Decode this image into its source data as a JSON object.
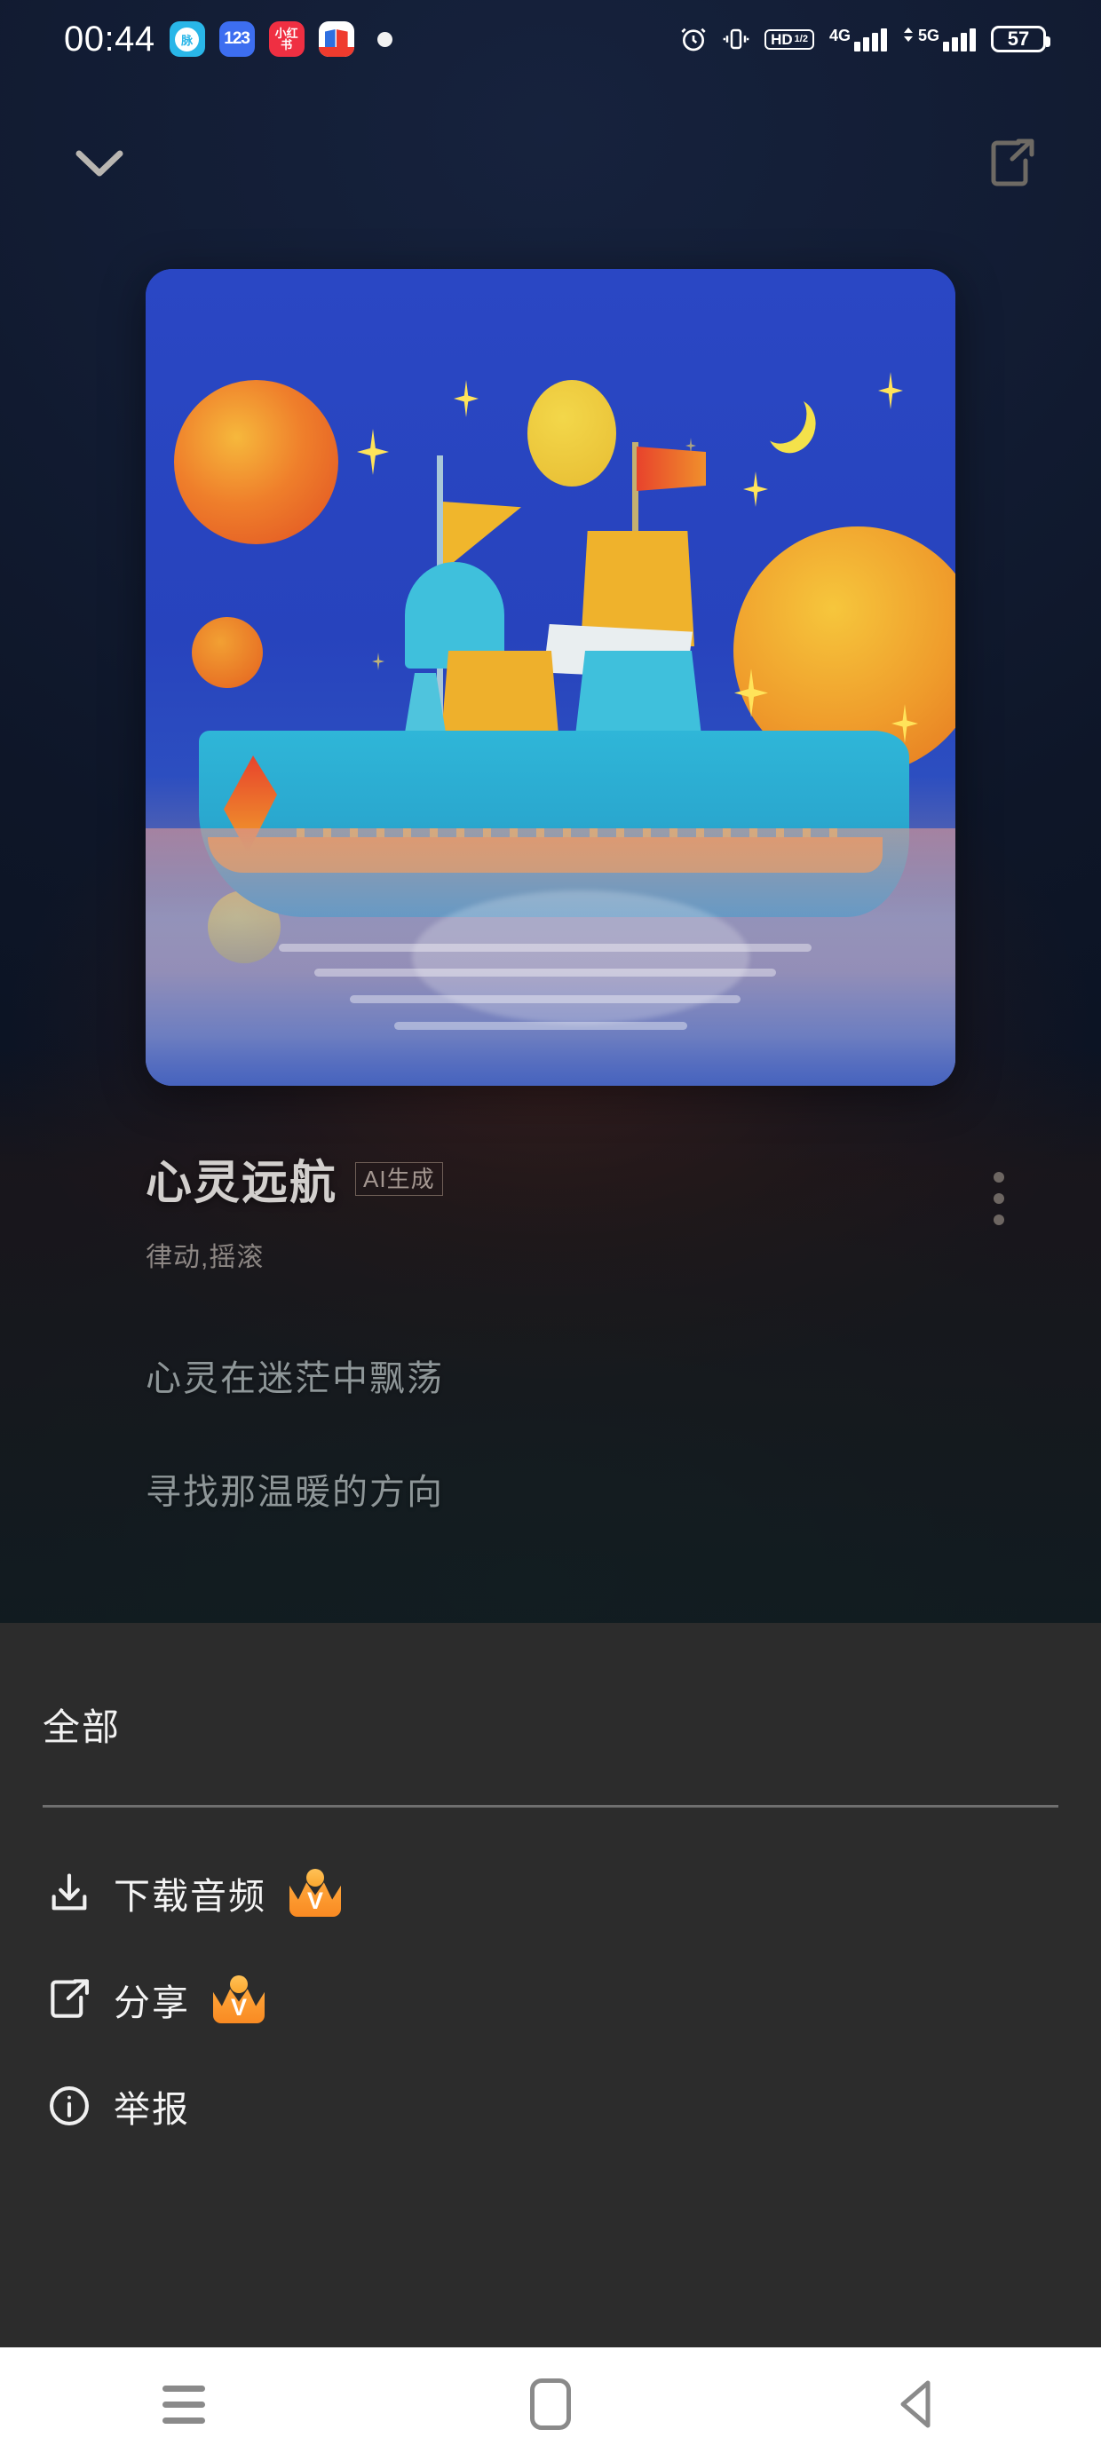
{
  "status_bar": {
    "time": "00:44",
    "app_icons": [
      {
        "name": "maimai-app-icon",
        "label": "脉"
      },
      {
        "name": "app-123-icon",
        "label": "123"
      },
      {
        "name": "xiaohongshu-app-icon",
        "label": "小红书"
      },
      {
        "name": "merchant-assistant-app-icon",
        "label": "商家助手"
      }
    ],
    "notification_dot": "•",
    "right_icons": [
      {
        "name": "alarm-icon",
        "label": "alarm"
      },
      {
        "name": "vibrate-icon",
        "label": "vibrate"
      },
      {
        "name": "volte-hd-icon",
        "label": "HD",
        "sim": "1/2"
      },
      {
        "name": "signal-4g-icon",
        "label": "4G"
      },
      {
        "name": "signal-5g-icon",
        "label": "5G"
      }
    ],
    "battery_percent": "57"
  },
  "top_bar": {
    "collapse_icon": "chevron-down-icon",
    "share_icon": "share-icon"
  },
  "album_art": {
    "name": "album-artwork",
    "description": "AI generated illustration of a sailing ship on a pink sea under a starry night sky with moons and planets",
    "colors": {
      "sky": "#2a47c4",
      "hull": "#2fb6d8",
      "sail_red": "#e8432c",
      "sail_yellow": "#f0a02c",
      "sea": "#d69696",
      "star": "#ffe35a",
      "moon_orange": "#e8652a",
      "moon_yellow": "#f2c13c"
    }
  },
  "song": {
    "title": "心灵远航",
    "ai_badge": "AI生成",
    "subtitle": "律动,摇滚",
    "more_icon": "more-vertical-icon"
  },
  "lyrics": [
    "心灵在迷茫中飘荡",
    "寻找那温暖的方向"
  ],
  "sheet": {
    "title": "全部",
    "items": [
      {
        "label": "下载音频",
        "icon": "download-icon",
        "vip": true,
        "vip_badge": "V"
      },
      {
        "label": "分享",
        "icon": "share-icon",
        "vip": true,
        "vip_badge": "V"
      },
      {
        "label": "举报",
        "icon": "info-icon",
        "vip": false,
        "vip_badge": ""
      }
    ]
  },
  "nav_bar": {
    "recents": "recents-icon",
    "home": "home-icon",
    "back": "back-icon"
  },
  "theme": {
    "sheet_bg": "#2c2c2c",
    "accent_vip": "#f98a22",
    "text_primary": "#f4f4f4",
    "text_muted": "#8d8784",
    "nav_bg": "#ffffff"
  }
}
